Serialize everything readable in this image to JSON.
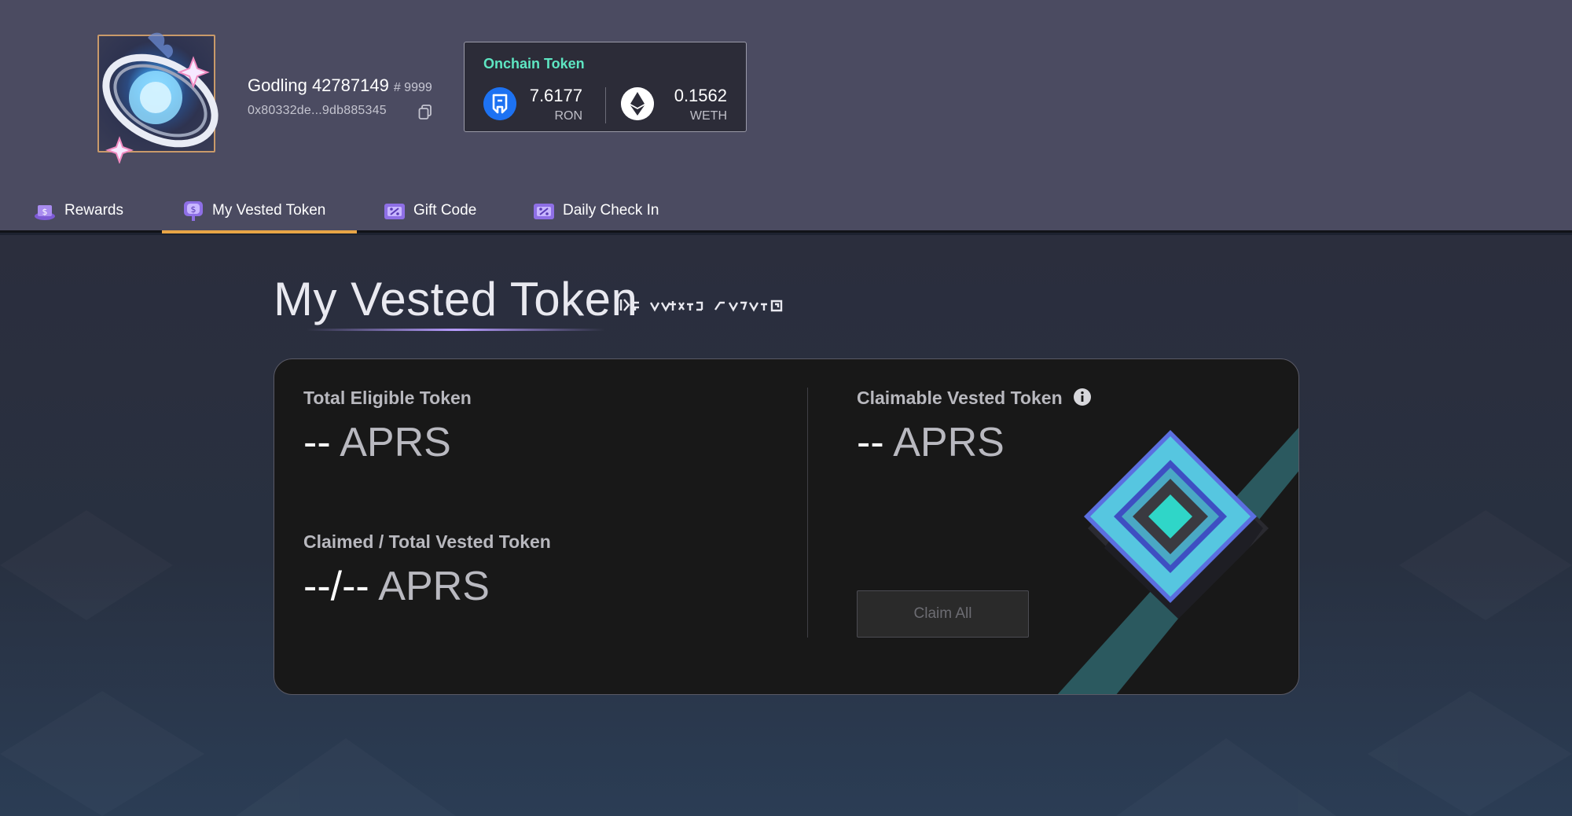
{
  "profile": {
    "name": "Godling 42787149",
    "id_tag": "# 9999",
    "address": "0x80332de...9db885345"
  },
  "onchain_token": {
    "title": "Onchain Token",
    "ron": {
      "value": "7.6177",
      "unit": "RON"
    },
    "weth": {
      "value": "0.1562",
      "unit": "WETH"
    }
  },
  "tabs": [
    {
      "label": "Rewards",
      "active": false
    },
    {
      "label": "My Vested Token",
      "active": true
    },
    {
      "label": "Gift Code",
      "active": false
    },
    {
      "label": "Daily Check In",
      "active": false
    }
  ],
  "page": {
    "title": "My Vested Token"
  },
  "card": {
    "total_eligible": {
      "label": "Total Eligible Token",
      "amount": "--",
      "unit": " APRS"
    },
    "claimed_total": {
      "label": "Claimed / Total Vested Token",
      "amount": "--/--",
      "unit": " APRS"
    },
    "claimable": {
      "label": "Claimable Vested Token",
      "amount": "--",
      "unit": " APRS"
    },
    "claim_button": "Claim All"
  },
  "colors": {
    "header_bg": "#4b4b61",
    "accent_tab": "#e8a546",
    "token_title": "#5ee6c2",
    "card_bg": "#181818"
  }
}
